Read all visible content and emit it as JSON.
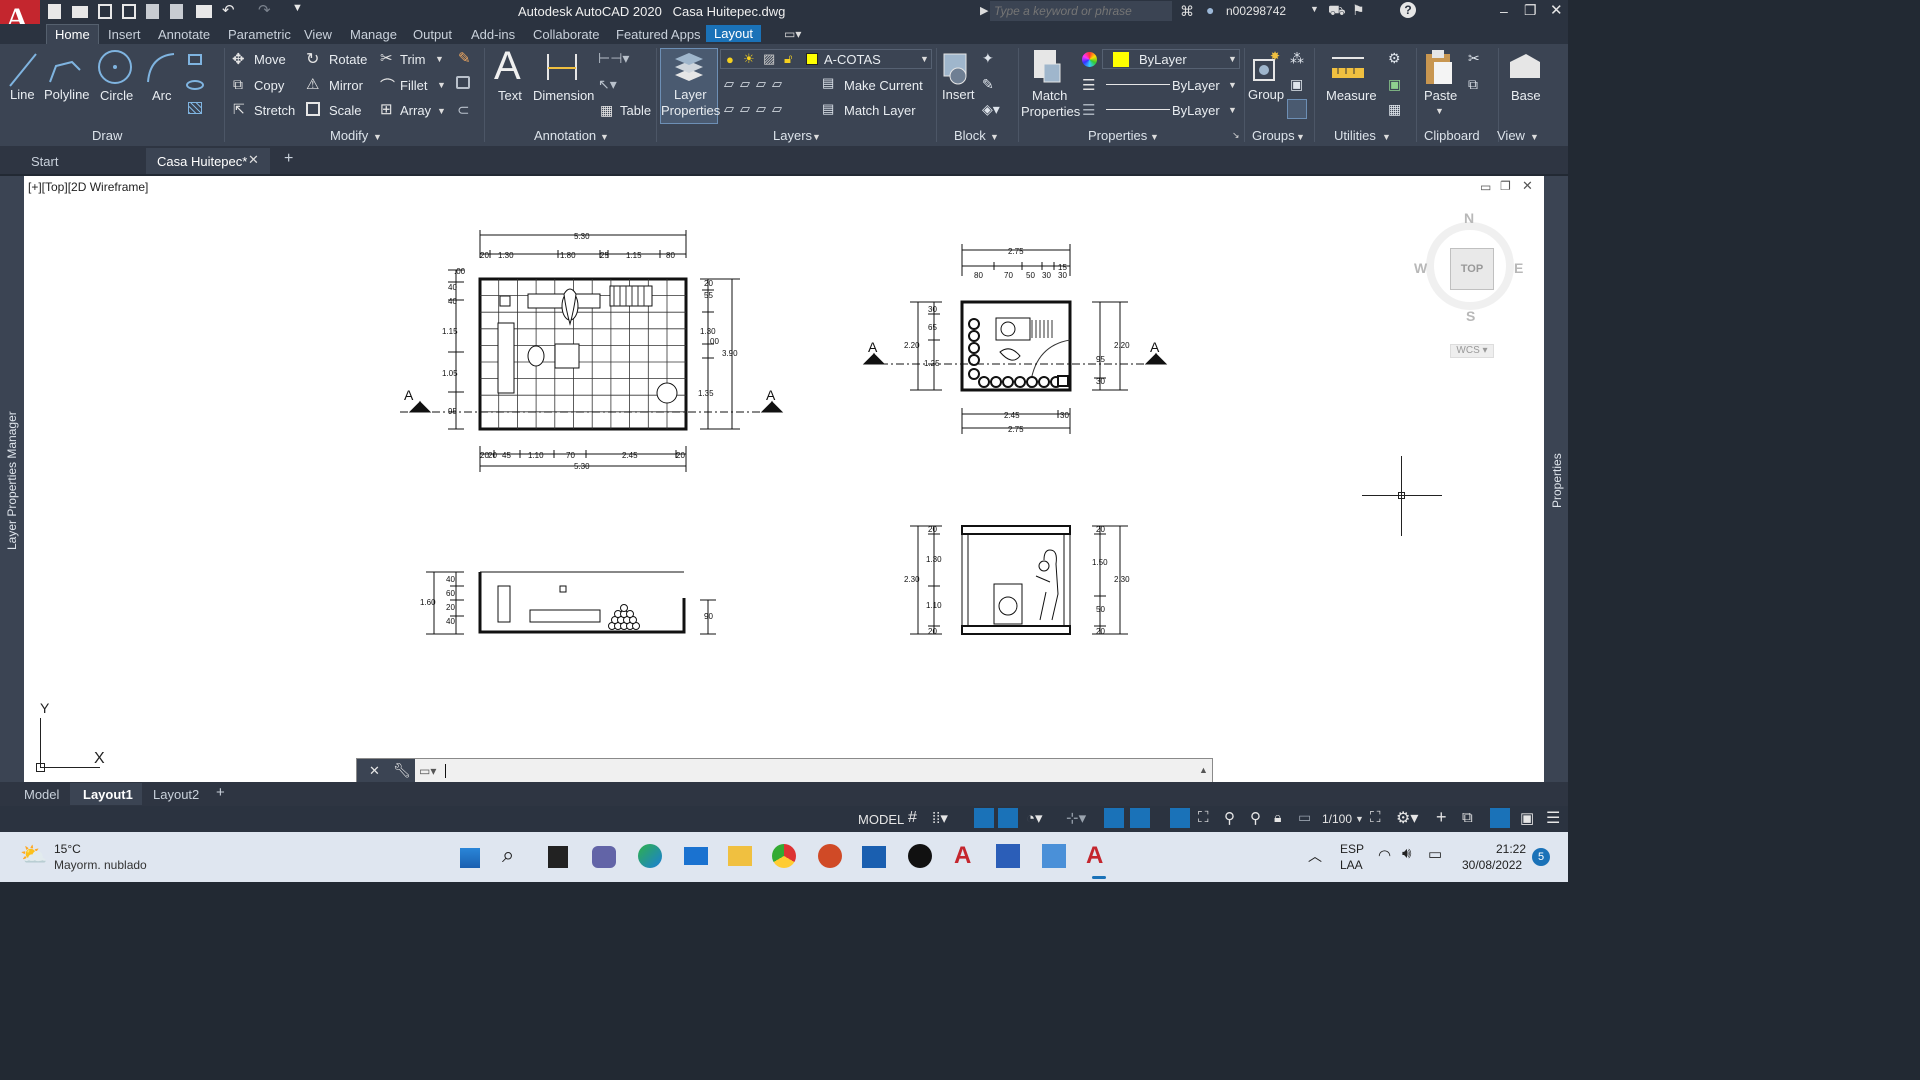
{
  "app": {
    "title": "Autodesk AutoCAD 2020",
    "file": "Casa Huitepec.dwg",
    "logo": "A"
  },
  "search": {
    "placeholder": "Type a keyword or phrase"
  },
  "user": {
    "name": "n00298742"
  },
  "ribbon_tabs": [
    "Home",
    "Insert",
    "Annotate",
    "Parametric",
    "View",
    "Manage",
    "Output",
    "Add-ins",
    "Collaborate",
    "Featured Apps",
    "Layout"
  ],
  "draw": {
    "line": "Line",
    "polyline": "Polyline",
    "circle": "Circle",
    "arc": "Arc",
    "panel": "Draw"
  },
  "modify": {
    "move": "Move",
    "rotate": "Rotate",
    "trim": "Trim",
    "copy": "Copy",
    "mirror": "Mirror",
    "fillet": "Fillet",
    "stretch": "Stretch",
    "scale": "Scale",
    "array": "Array",
    "panel": "Modify"
  },
  "annotation": {
    "text": "Text",
    "dimension": "Dimension",
    "table": "Table",
    "panel": "Annotation"
  },
  "layers": {
    "layer_properties_1": "Layer",
    "layer_properties_2": "Properties",
    "current_layer": "A-COTAS",
    "make_current": "Make Current",
    "match_layer": "Match Layer",
    "panel": "Layers"
  },
  "block": {
    "insert": "Insert",
    "panel": "Block"
  },
  "properties": {
    "match_1": "Match",
    "match_2": "Properties",
    "color": "ByLayer",
    "linetype": "ByLayer",
    "lineweight": "ByLayer",
    "panel": "Properties"
  },
  "groups": {
    "group": "Group",
    "panel": "Groups"
  },
  "utilities": {
    "measure": "Measure",
    "panel": "Utilities"
  },
  "clipboard": {
    "paste": "Paste",
    "panel": "Clipboard"
  },
  "view": {
    "base": "Base",
    "panel": "View"
  },
  "doc_tabs": {
    "start": "Start",
    "active": "Casa Huitepec*"
  },
  "viewport": {
    "label": "[+][Top][2D Wireframe]"
  },
  "viewcube": {
    "north": "N",
    "south": "S",
    "east": "E",
    "west": "W",
    "face": "TOP",
    "wcs": "WCS"
  },
  "ucs": {
    "x": "X",
    "y": "Y"
  },
  "palettes": {
    "left": "Layer Properties Manager",
    "right": "Properties"
  },
  "drawing": {
    "plan1": {
      "top_total": "5.30",
      "top_parts": [
        "20",
        "1.30",
        "1.80",
        "25",
        "1.15",
        "80"
      ],
      "left": [
        ".00",
        "40",
        "40",
        "1.15",
        "1.05",
        "95"
      ],
      "right": [
        "20",
        "55",
        "1.30",
        "00",
        "1.35"
      ],
      "right_total": "3.90",
      "bottom_parts": [
        "20",
        "20",
        "45",
        "1.10",
        "70",
        "2.45",
        "20"
      ],
      "bottom_total": "5.30"
    },
    "plan2": {
      "top_total": "2.75",
      "top_parts": [
        "80",
        "70",
        "50",
        "30",
        "30"
      ],
      "top_small": "15",
      "left_total": "2.20",
      "left": [
        "30",
        "65",
        "1.25"
      ],
      "right_total": "2.20",
      "right": [
        "95",
        "30"
      ],
      "bottom": [
        "2.45",
        "30"
      ],
      "bottom_total": "2.75"
    },
    "section1": {
      "left_total": "1.60",
      "left": [
        "40",
        "60",
        "20",
        "40"
      ],
      "right": "90"
    },
    "section2": {
      "left_total": "2.30",
      "left": [
        "20",
        "1.30",
        "1.10",
        "20"
      ],
      "right_total": "2.30",
      "right": [
        "20",
        "1.50",
        "50",
        "20"
      ]
    },
    "cut_mark": "A"
  },
  "layout_tabs": [
    "Model",
    "Layout1",
    "Layout2"
  ],
  "status": {
    "space": "MODEL",
    "scale": "1/100"
  },
  "weather": {
    "temp": "15°C",
    "desc": "Mayorm. nublado"
  },
  "tray": {
    "lang1": "ESP",
    "lang2": "LAA",
    "time": "21:22",
    "date": "30/08/2022",
    "badge": "5"
  }
}
